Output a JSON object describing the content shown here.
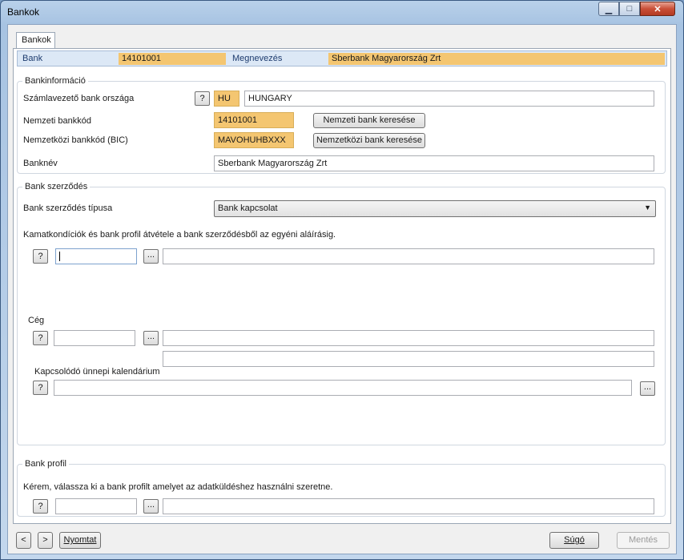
{
  "window": {
    "title": "Bankok",
    "minimize_glyph": "▁",
    "maximize_glyph": "□",
    "close_glyph": "✕"
  },
  "tab": {
    "label": "Bankok"
  },
  "header": {
    "bank_label": "Bank",
    "bank_value": "14101001",
    "name_label": "Megnevezés",
    "name_value": "Sberbank Magyarország Zrt"
  },
  "bankinfo": {
    "legend": "Bankinformáció",
    "country_label": "Számlavezető bank országa",
    "country_code": "HU",
    "country_name": "HUNGARY",
    "national_code_label": "Nemzeti bankkód",
    "national_code": "14101001",
    "national_search_button": "Nemzeti bank keresése",
    "bic_label": "Nemzetközi bankkód (BIC)",
    "bic": "MAVOHUHBXXX",
    "bic_search_button": "Nemzetközi bank keresése",
    "bankname_label": "Banknév",
    "bankname": "Sberbank Magyarország Zrt"
  },
  "contract": {
    "legend": "Bank szerződés",
    "type_label": "Bank szerződés típusa",
    "type_value": "Bank kapcsolat",
    "note": "Kamatkondíciók és bank profil átvétele a bank szerződésből az egyéni aláírásig.",
    "contract_code": "",
    "contract_desc": "",
    "company_label": "Cég",
    "company_code": "",
    "company_name": "",
    "company_name2": "",
    "calendar_label": "Kapcsolódó ünnepi kalendárium",
    "calendar_value": ""
  },
  "profile": {
    "legend": "Bank profil",
    "instruction": "Kérem, válassza ki a bank profilt amelyet az adatküldéshez használni szeretne.",
    "profile_code": "",
    "profile_desc": ""
  },
  "common": {
    "question_glyph": "?",
    "ellipsis_glyph": "..."
  },
  "footer": {
    "prev_glyph": "<",
    "next_glyph": ">",
    "print_button": "Nyomtat",
    "help_button": "Súgó",
    "save_button": "Mentés"
  }
}
